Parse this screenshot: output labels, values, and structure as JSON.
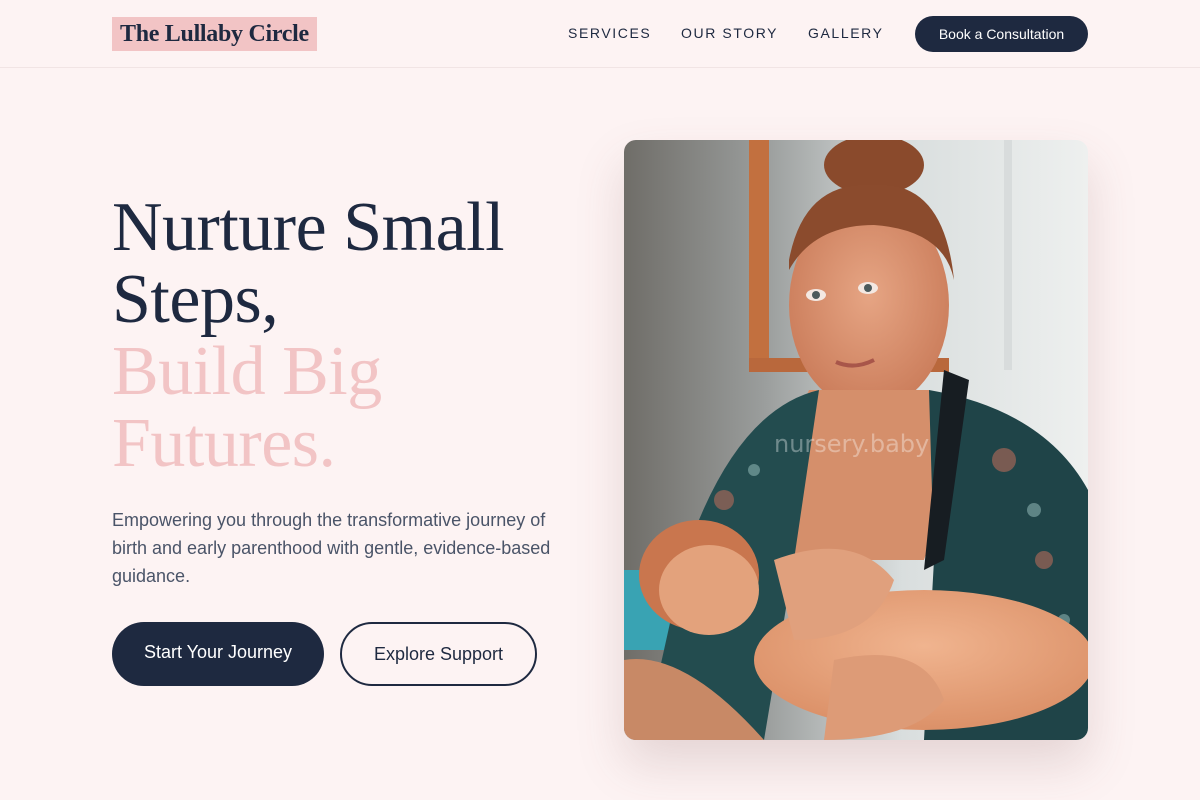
{
  "header": {
    "logo": "The Lullaby Circle",
    "nav": [
      "SERVICES",
      "OUR STORY",
      "GALLERY"
    ],
    "cta": "Book a Consultation"
  },
  "hero": {
    "title_line1": "Nurture Small",
    "title_line2": "Steps,",
    "title_accent_line1": "Build Big",
    "title_accent_line2": "Futures.",
    "description": "Empowering you through the transformative journey of birth and early parenthood with gentle, evidence-based guidance.",
    "primary_button": "Start Your Journey",
    "secondary_button": "Explore Support"
  },
  "photo": {
    "watermark": "nursery.baby",
    "icon": "mother-breastfeeding-photo"
  },
  "colors": {
    "background": "#fdf3f3",
    "navy": "#1e2940",
    "pink_accent": "#f2c4c5",
    "body_text": "#4a5468"
  }
}
